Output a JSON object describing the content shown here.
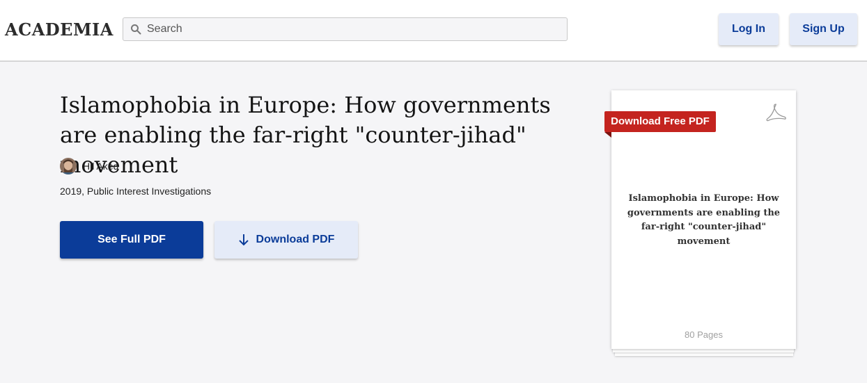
{
  "header": {
    "logo": "ACADEMIA",
    "search": {
      "placeholder": "Search",
      "icon": "search-icon"
    },
    "login_label": "Log In",
    "signup_label": "Sign Up"
  },
  "paper": {
    "title": "Islamophobia in Europe: How governments are enabling the far-right \"counter-jihad\" movement",
    "author": {
      "name": "Hil Aked",
      "avatar": "avatar-icon"
    },
    "meta": "2019, Public Interest Investigations"
  },
  "actions": {
    "see_full_pdf": "See Full PDF",
    "download_pdf": "Download PDF",
    "download_icon": "download-arrow-icon"
  },
  "preview": {
    "ribbon": "Download Free PDF",
    "icon": "pdf-icon",
    "title": "Islamophobia in Europe: How governments are enabling the far-right \"counter-jihad\" movement",
    "pages": "80 Pages"
  },
  "colors": {
    "brand_blue": "#0b3c99",
    "light_button": "#e5ebf8",
    "ribbon_red": "#c4241f",
    "page_bg": "#f5f5f7"
  }
}
